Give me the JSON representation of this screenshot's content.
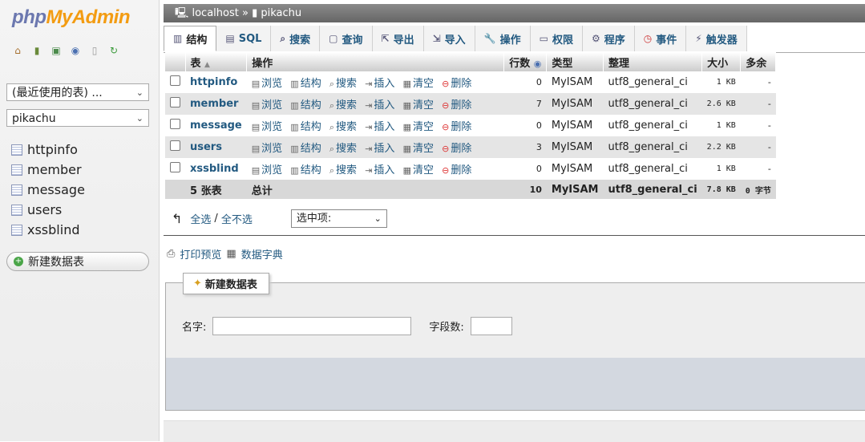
{
  "app": {
    "logo_part1": "php",
    "logo_part2": "MyAdmin"
  },
  "sidebar": {
    "recent_select": "(最近使用的表) ...",
    "db_select": "pikachu",
    "tables": [
      "httpinfo",
      "member",
      "message",
      "users",
      "xssblind"
    ],
    "new_table": "新建数据表",
    "nav_icons": [
      "home-icon",
      "exit-icon",
      "query-icon",
      "help-icon",
      "docs-icon",
      "reload-icon"
    ]
  },
  "breadcrumb": {
    "server": "localhost",
    "sep": "»",
    "database": "pikachu"
  },
  "tabs": [
    {
      "label": "结构",
      "icon": "structure-icon",
      "active": true
    },
    {
      "label": "SQL",
      "icon": "sql-icon"
    },
    {
      "label": "搜索",
      "icon": "search-icon"
    },
    {
      "label": "查询",
      "icon": "query-icon"
    },
    {
      "label": "导出",
      "icon": "export-icon"
    },
    {
      "label": "导入",
      "icon": "import-icon"
    },
    {
      "label": "操作",
      "icon": "wrench-icon"
    },
    {
      "label": "权限",
      "icon": "privileges-icon"
    },
    {
      "label": "程序",
      "icon": "routines-icon"
    },
    {
      "label": "事件",
      "icon": "clock-icon"
    },
    {
      "label": "触发器",
      "icon": "triggers-icon"
    }
  ],
  "table": {
    "headers": {
      "table": "表",
      "sort_arrow": "▲",
      "actions": "操作",
      "rows": "行数",
      "type": "类型",
      "collation": "整理",
      "size": "大小",
      "overhead": "多余"
    },
    "actions": {
      "browse": "浏览",
      "structure": "结构",
      "search": "搜索",
      "insert": "插入",
      "empty": "清空",
      "drop": "删除"
    },
    "rows": [
      {
        "name": "httpinfo",
        "rows": "0",
        "type": "MyISAM",
        "collation": "utf8_general_ci",
        "size": "1 KB",
        "overhead": "-"
      },
      {
        "name": "member",
        "rows": "7",
        "type": "MyISAM",
        "collation": "utf8_general_ci",
        "size": "2.6 KB",
        "overhead": "-"
      },
      {
        "name": "message",
        "rows": "0",
        "type": "MyISAM",
        "collation": "utf8_general_ci",
        "size": "1 KB",
        "overhead": "-"
      },
      {
        "name": "users",
        "rows": "3",
        "type": "MyISAM",
        "collation": "utf8_general_ci",
        "size": "2.2 KB",
        "overhead": "-"
      },
      {
        "name": "xssblind",
        "rows": "0",
        "type": "MyISAM",
        "collation": "utf8_general_ci",
        "size": "1 KB",
        "overhead": "-"
      }
    ],
    "footer": {
      "count": "5 张表",
      "total": "总计",
      "rows": "10",
      "type": "MyISAM",
      "collation": "utf8_general_ci",
      "size": "7.8 KB",
      "overhead": "0 字节"
    }
  },
  "bulk": {
    "check_all": "全选",
    "slash": "/",
    "uncheck_all": "全不选",
    "with_selected": "选中项:"
  },
  "print": {
    "print_view": "打印预览",
    "data_dict": "数据字典"
  },
  "create": {
    "legend": "新建数据表",
    "name_label": "名字:",
    "name_value": "",
    "fields_label": "字段数:",
    "fields_value": ""
  }
}
